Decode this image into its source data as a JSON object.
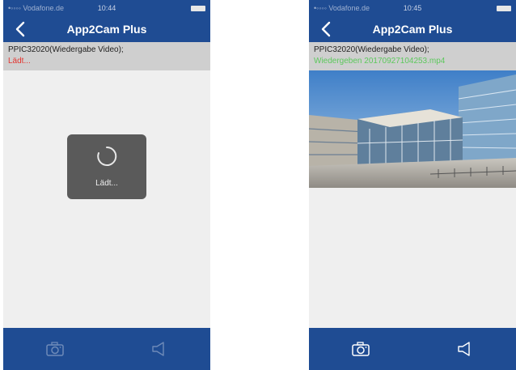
{
  "screens": [
    {
      "status_bar": {
        "carrier": "•◦◦◦◦ Vodafone.de",
        "time": "10:44"
      },
      "nav": {
        "title": "App2Cam Plus"
      },
      "info": {
        "device": "PPIC32020(Wiedergabe Video);",
        "status": "Lädt..."
      },
      "loading": {
        "label": "Lädt..."
      },
      "toolbar": {
        "camera_icon": "camera-icon",
        "speaker_icon": "speaker-icon",
        "enabled": false
      }
    },
    {
      "status_bar": {
        "carrier": "•◦◦◦◦ Vodafone.de",
        "time": "10:45"
      },
      "nav": {
        "title": "App2Cam Plus"
      },
      "info": {
        "device": "PPIC32020(Wiedergabe Video);",
        "status": "Wiedergeben 20170927104253.mp4"
      },
      "video": {
        "description": "building-video-frame"
      },
      "toolbar": {
        "camera_icon": "camera-icon",
        "speaker_icon": "speaker-icon",
        "enabled": true
      }
    }
  ],
  "colors": {
    "brand": "#1f4c93",
    "info_bg": "#cfcfcf",
    "loading_red": "#e3342f",
    "playing_green": "#5cc85c"
  }
}
